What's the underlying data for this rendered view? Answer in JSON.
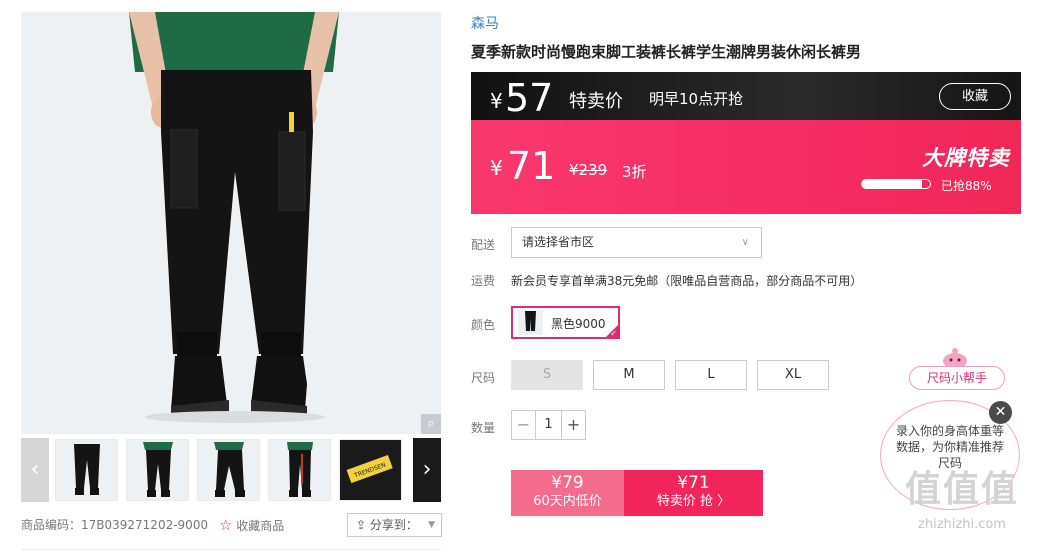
{
  "gallery": {
    "zoom_icon": "magnifier-icon",
    "prev_icon": "chevron-left-icon",
    "next_icon": "chevron-right-icon",
    "thumb_count": 6,
    "label_text": "TRENDSEN"
  },
  "product": {
    "code_label": "商品编码：17B039271202-9000",
    "fav_label": "收藏商品",
    "share_label": "分享到：",
    "brand": "森马",
    "title": "夏季新款时尚慢跑束脚工装裤长裤学生潮牌男装休闲长裤男"
  },
  "price_top": {
    "currency": "¥",
    "amount": "57",
    "tag": "特卖价",
    "start": "明早10点开抢",
    "fav_button": "收藏"
  },
  "price_pink": {
    "currency": "¥",
    "amount": "71",
    "original": "¥239",
    "discount": "3折",
    "badge": "大牌特卖",
    "sold_text": "已抢88%",
    "sold_fraction": 0.88
  },
  "delivery": {
    "label": "配送",
    "select": "请选择省市区"
  },
  "shipping": {
    "label": "运费",
    "text": "新会员专享首单满38元免邮（限唯品自营商品，部分商品不可用）"
  },
  "color": {
    "label": "颜色",
    "option": "黑色9000"
  },
  "size": {
    "label": "尺码",
    "options": [
      "S",
      "M",
      "L",
      "XL"
    ]
  },
  "quantity": {
    "label": "数量",
    "value": "1",
    "minus": "−",
    "plus": "+"
  },
  "buy": {
    "left_price": "¥79",
    "left_sub": "60天内低价",
    "right_price": "¥71",
    "right_sub": "特卖价 抢 〉"
  },
  "helper": {
    "pill": "尺码小帮手",
    "bubble": "录入你的身高体重等数据，为你精准推荐尺码",
    "close": "✕"
  },
  "watermark": {
    "zh": "值值值",
    "en": "zhizhizhi.com"
  },
  "colors": {
    "accent": "#e02a76",
    "brand_blue": "#3f7fcc",
    "price_pink": "#f52a62"
  }
}
